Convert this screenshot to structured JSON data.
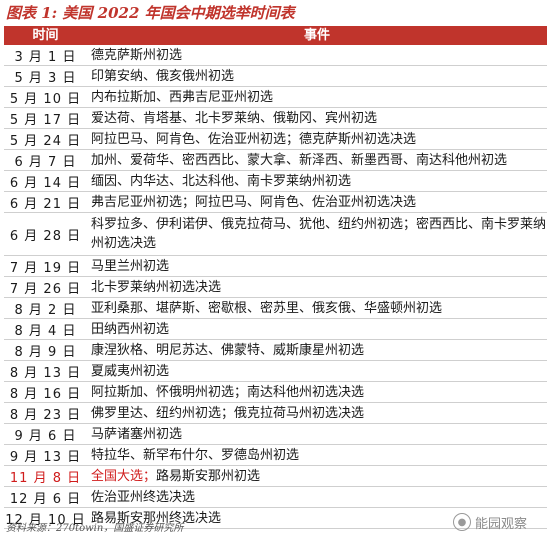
{
  "title": "图表 1:  美国 2022 年国会中期选举时间表",
  "table": {
    "headers": [
      "时间",
      "事件"
    ],
    "rows": [
      {
        "date": "3 月 1 日",
        "event": "德克萨斯州初选",
        "event_tail": ""
      },
      {
        "date": "5 月 3 日",
        "event": "印第安纳、俄亥俄州初选",
        "event_tail": ""
      },
      {
        "date": "5 月 10 日",
        "event": "内布拉斯加、西弗吉尼亚州初选",
        "event_tail": ""
      },
      {
        "date": "5 月 17 日",
        "event": "爱达荷、肯塔基、北卡罗莱纳、俄勒冈、宾州初选",
        "event_tail": ""
      },
      {
        "date": "5 月 24 日",
        "event": "阿拉巴马、阿肯色、佐治亚州初选；德克萨斯州初选决选",
        "event_tail": ""
      },
      {
        "date": "6 月 7 日",
        "event": "加州、爱荷华、密西西比、蒙大拿、新泽西、新墨西哥、南达科他州初选",
        "event_tail": ""
      },
      {
        "date": "6 月 14 日",
        "event": "缅因、内华达、北达科他、南卡罗莱纳州初选",
        "event_tail": ""
      },
      {
        "date": "6 月 21 日",
        "event": "弗吉尼亚州初选；阿拉巴马、阿肯色、佐治亚州初选决选",
        "event_tail": ""
      },
      {
        "date": "6 月 28 日",
        "event": "科罗拉多、伊利诺伊、俄克拉荷马、犹他、纽约州初选；密西西比、南卡罗莱纳州初选决选",
        "event_tail": ""
      },
      {
        "date": "7 月 19 日",
        "event": "马里兰州初选",
        "event_tail": ""
      },
      {
        "date": "7 月 26 日",
        "event": "北卡罗莱纳州初选决选",
        "event_tail": ""
      },
      {
        "date": "8 月 2 日",
        "event": "亚利桑那、堪萨斯、密歇根、密苏里、俄亥俄、华盛顿州初选",
        "event_tail": ""
      },
      {
        "date": "8 月 4 日",
        "event": "田纳西州初选",
        "event_tail": ""
      },
      {
        "date": "8 月 9 日",
        "event": "康涅狄格、明尼苏达、佛蒙特、威斯康星州初选",
        "event_tail": ""
      },
      {
        "date": "8 月 13 日",
        "event": "夏威夷州初选",
        "event_tail": ""
      },
      {
        "date": "8 月 16 日",
        "event": "阿拉斯加、怀俄明州初选；南达科他州初选决选",
        "event_tail": ""
      },
      {
        "date": "8 月 23 日",
        "event": "佛罗里达、纽约州初选；俄克拉荷马州初选决选",
        "event_tail": ""
      },
      {
        "date": "9 月 6 日",
        "event": "马萨诸塞州初选",
        "event_tail": ""
      },
      {
        "date": "9 月 13 日",
        "event": "特拉华、新罕布什尔、罗德岛州初选",
        "event_tail": ""
      },
      {
        "date": "11 月 8 日",
        "event": "全国大选；",
        "event_tail": "路易斯安那州初选"
      },
      {
        "date": "12 月 6 日",
        "event": "佐治亚州终选决选",
        "event_tail": ""
      },
      {
        "date": "12 月 10 日",
        "event": "路易斯安那州终选决选",
        "event_tail": ""
      }
    ]
  },
  "source": "资料来源：270towin，国盛证券研究所",
  "watermark": "能园观察",
  "colors": {
    "accent": "#c0342c",
    "highlight_text": "#d01c1c"
  }
}
